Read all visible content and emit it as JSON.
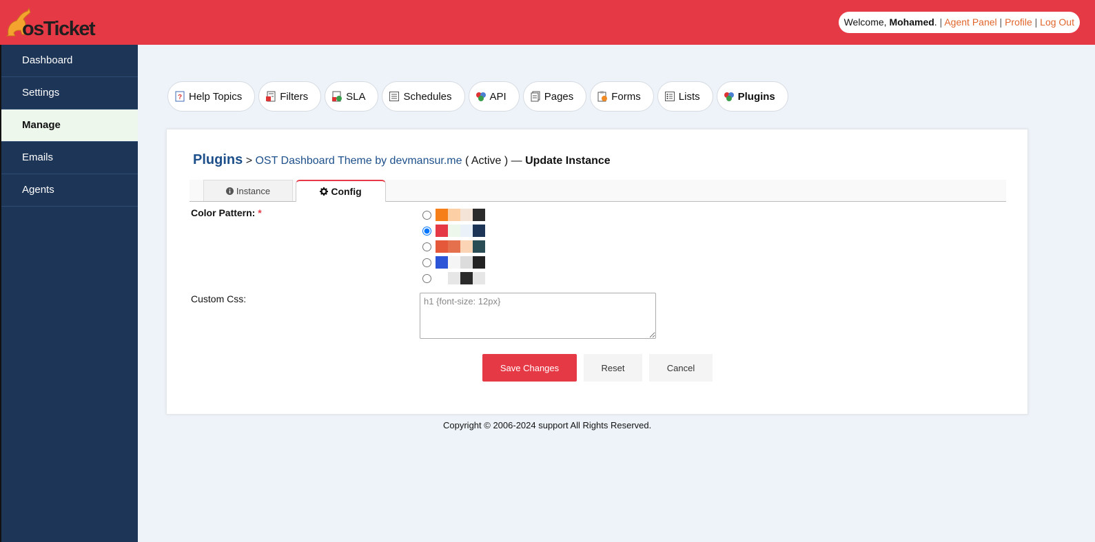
{
  "header": {
    "logo_text": "osTicket",
    "welcome_prefix": "Welcome, ",
    "user_name": "Mohamed",
    "welcome_suffix": ". ",
    "links": [
      "Agent Panel",
      "Profile",
      "Log Out"
    ]
  },
  "sidebar": {
    "items": [
      {
        "label": "Dashboard"
      },
      {
        "label": "Settings"
      },
      {
        "label": "Manage"
      },
      {
        "label": "Emails"
      },
      {
        "label": "Agents"
      }
    ],
    "active": "Manage"
  },
  "manage_tabs": [
    {
      "label": "Help Topics",
      "icon": "help-topics-icon"
    },
    {
      "label": "Filters",
      "icon": "filters-icon"
    },
    {
      "label": "SLA",
      "icon": "sla-icon"
    },
    {
      "label": "Schedules",
      "icon": "schedules-icon"
    },
    {
      "label": "API",
      "icon": "api-icon"
    },
    {
      "label": "Pages",
      "icon": "pages-icon"
    },
    {
      "label": "Forms",
      "icon": "forms-icon"
    },
    {
      "label": "Lists",
      "icon": "lists-icon"
    },
    {
      "label": "Plugins",
      "icon": "plugins-icon"
    }
  ],
  "breadcrumb": {
    "root": "Plugins",
    "separator": ">",
    "plugin": "OST Dashboard Theme by devmansur.me",
    "status": "( Active )",
    "dash": "—",
    "action": "Update Instance"
  },
  "subtabs": {
    "instance": "Instance",
    "config": "Config"
  },
  "form": {
    "color_pattern_label": "Color Pattern:",
    "required_mark": "*",
    "color_patterns": [
      {
        "colors": [
          "#f77f1a",
          "#fdcfa4",
          "#f3e4d7",
          "#2b2b2b"
        ],
        "selected": false
      },
      {
        "colors": [
          "#e63946",
          "#edf7ec",
          "#eaf1f8",
          "#1d3557"
        ],
        "selected": true
      },
      {
        "colors": [
          "#e5583a",
          "#e4704e",
          "#fbd3b5",
          "#2a4d55"
        ],
        "selected": false
      },
      {
        "colors": [
          "#2b55d6",
          "#f5f5f5",
          "#dcdcdc",
          "#222222"
        ],
        "selected": false
      },
      {
        "colors": [
          "#ffffff",
          "#e6e6e6",
          "#2b2b2b",
          "#e6e6e6"
        ],
        "selected": false
      }
    ],
    "custom_css_label": "Custom Css:",
    "custom_css_placeholder": "h1 {font-size: 12px}",
    "custom_css_value": ""
  },
  "buttons": {
    "save": "Save Changes",
    "reset": "Reset",
    "cancel": "Cancel"
  },
  "footer": {
    "copyright": "Copyright © 2006-2024 support All Rights Reserved."
  },
  "colors": {
    "brand_red": "#e63946",
    "sidebar_navy": "#1d3557",
    "link_orange": "#e0652b",
    "link_blue": "#1d4f8a",
    "background": "#eef3f9"
  }
}
